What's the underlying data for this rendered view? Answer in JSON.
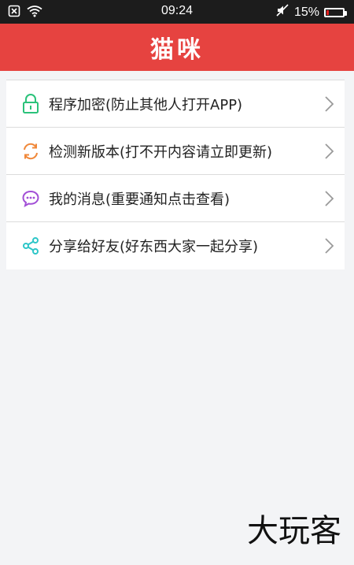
{
  "status_bar": {
    "time": "09:24",
    "battery_text": "15%"
  },
  "header": {
    "title": "猫咪"
  },
  "menu": {
    "items": [
      {
        "label": "程序加密(防止其他人打开APP)",
        "icon": "lock-icon",
        "color": "#2bc27a"
      },
      {
        "label": "检测新版本(打不开内容请立即更新)",
        "icon": "refresh-icon",
        "color": "#f0883a"
      },
      {
        "label": "我的消息(重要通知点击查看)",
        "icon": "message-icon",
        "color": "#a24fd6"
      },
      {
        "label": "分享给好友(好东西大家一起分享)",
        "icon": "share-icon",
        "color": "#2ec6c8"
      }
    ]
  },
  "watermark": {
    "text": "大玩客"
  }
}
